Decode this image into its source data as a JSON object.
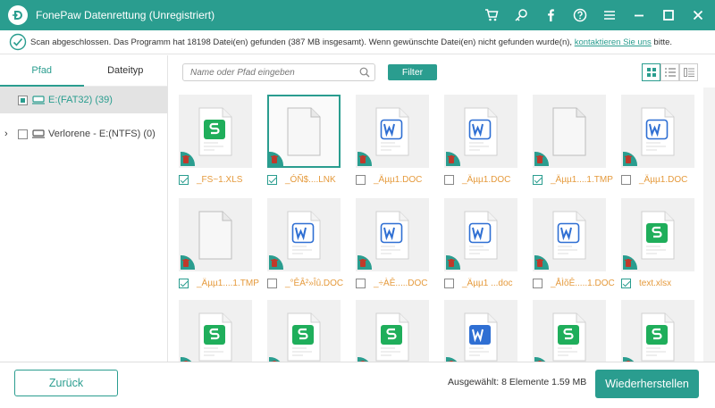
{
  "app": {
    "title": "FonePaw Datenrettung (Unregistriert)",
    "accent": "#2a9d8f",
    "label_color": "#e59a3c"
  },
  "titlebar_icons": [
    "cart-icon",
    "key-icon",
    "facebook-icon",
    "help-icon",
    "menu-icon",
    "minimize-icon",
    "maximize-icon",
    "close-icon"
  ],
  "status": {
    "text": "Scan abgeschlossen. Das Programm hat 18198 Datei(en) gefunden (387 MB insgesamt). Wenn gewünschte Datei(en) nicht gefunden wurde(n), ",
    "link": "kontaktieren Sie uns",
    "suffix": " bitte."
  },
  "left": {
    "tabs": [
      {
        "label": "Pfad",
        "active": true
      },
      {
        "label": "Dateityp",
        "active": false
      }
    ],
    "tree": [
      {
        "label": "E:(FAT32) (39)",
        "selected": true,
        "state": "partial"
      },
      {
        "label": "Verlorene - E:(NTFS) (0)",
        "selected": false,
        "state": "none"
      }
    ]
  },
  "toolbar": {
    "search_placeholder": "Name oder Pfad eingeben",
    "filter_label": "Filter"
  },
  "files": [
    {
      "name": "_FS~1.XLS",
      "type": "xls",
      "checked": true,
      "selected": false,
      "orange": true
    },
    {
      "name": "_ÓÑ$....LNK",
      "type": "blank",
      "checked": true,
      "selected": true,
      "orange": true
    },
    {
      "name": "_Äµµ1.DOC",
      "type": "doc",
      "checked": false,
      "selected": false,
      "orange": true
    },
    {
      "name": "_Äµµ1.DOC",
      "type": "doc",
      "checked": false,
      "selected": false,
      "orange": true
    },
    {
      "name": "_Äµµ1....1.TMP",
      "type": "blank",
      "checked": true,
      "selected": false,
      "orange": true
    },
    {
      "name": "_Äµµ1.DOC",
      "type": "doc",
      "checked": false,
      "selected": false,
      "orange": true
    },
    {
      "name": "_Äµµ1....1.TMP",
      "type": "blank",
      "checked": true,
      "selected": false,
      "orange": true
    },
    {
      "name": "_°ÊÂ²»Îû.DOC",
      "type": "doc",
      "checked": false,
      "selected": false,
      "orange": true
    },
    {
      "name": "_÷ÀÊ.....DOC",
      "type": "doc",
      "checked": false,
      "selected": false,
      "orange": true
    },
    {
      "name": "_Äµµ1 ...doc",
      "type": "doc",
      "checked": false,
      "selected": false,
      "orange": true
    },
    {
      "name": "_ÅÌõÊ.....1.DOC",
      "type": "doc",
      "checked": false,
      "selected": false,
      "orange": true
    },
    {
      "name": "text.xlsx",
      "type": "xls",
      "checked": true,
      "selected": false,
      "orange": true
    },
    {
      "name": "",
      "type": "xls",
      "checked": false,
      "selected": false,
      "orange": true
    },
    {
      "name": "",
      "type": "xls",
      "checked": false,
      "selected": false,
      "orange": true
    },
    {
      "name": "",
      "type": "xls",
      "checked": false,
      "selected": false,
      "orange": true
    },
    {
      "name": "",
      "type": "doc-solid",
      "checked": false,
      "selected": false,
      "orange": true
    },
    {
      "name": "",
      "type": "xls",
      "checked": false,
      "selected": false,
      "orange": true
    },
    {
      "name": "",
      "type": "xls",
      "checked": false,
      "selected": false,
      "orange": true
    }
  ],
  "footer": {
    "back_label": "Zurück",
    "selected_info": "Ausgewählt: 8 Elemente 1.59 MB",
    "restore_label": "Wiederherstellen"
  }
}
